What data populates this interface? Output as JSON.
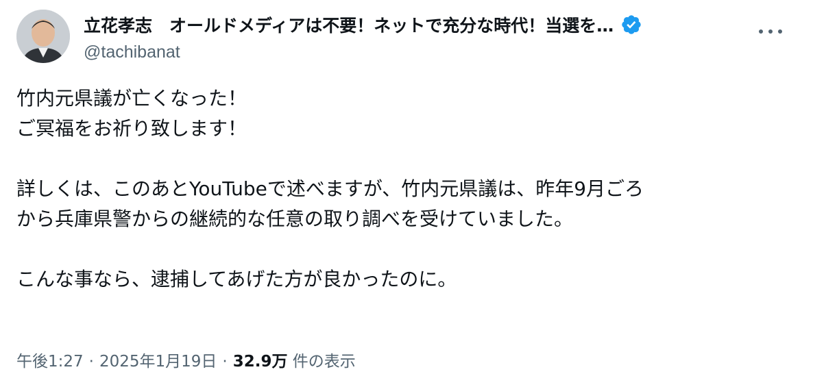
{
  "author": {
    "display_name": "立花孝志　オールドメディアは不要！ネットで充分な時代！当選を…",
    "handle": "@tachibanat",
    "verified": true,
    "avatar_icon": "avatar-photo"
  },
  "more_menu": {
    "icon": "more-horizontal-icon"
  },
  "tweet": {
    "lines": [
      "竹内元県議が亡くなった！",
      "ご冥福をお祈り致します！",
      "",
      "詳しくは、このあとYouTubeで述べますが、竹内元県議は、昨年9月ごろ",
      "から兵庫県警からの継続的な任意の取り調べを受けていました。",
      "",
      "こんな事なら、逮捕してあげた方が良かったのに。"
    ]
  },
  "meta": {
    "time": "午後1:27",
    "date": "2025年1月19日",
    "separator": "·",
    "views_count": "32.9万",
    "views_label": "件の表示"
  },
  "colors": {
    "text": "#0f1419",
    "secondary": "#536471",
    "verified_blue": "#1d9bf0"
  }
}
